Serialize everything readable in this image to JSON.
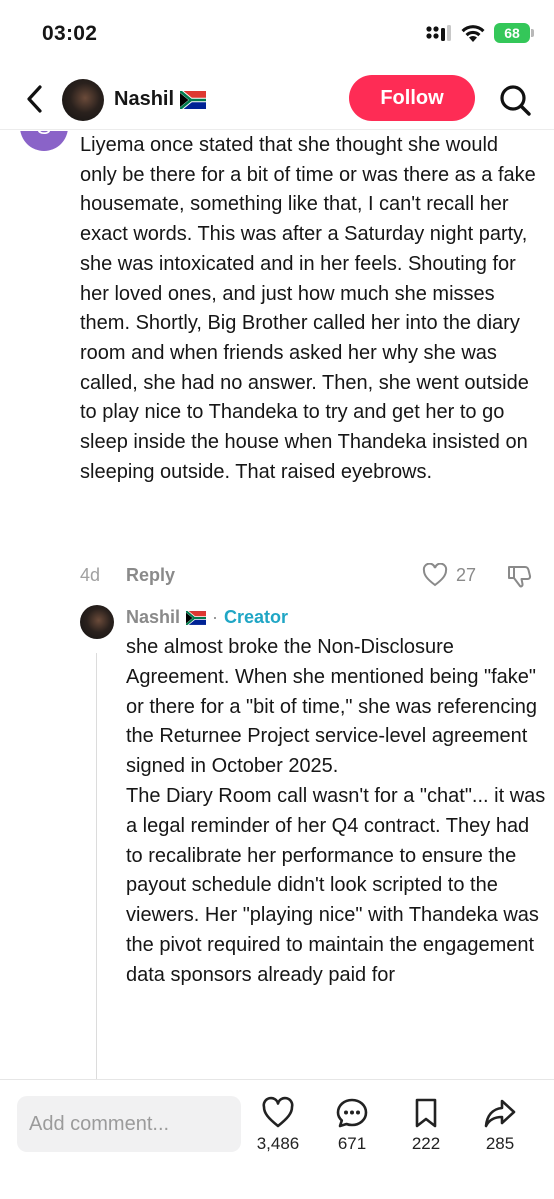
{
  "status_bar": {
    "time": "03:02",
    "battery": "68",
    "icons": [
      "signal-icon",
      "wifi-icon",
      "battery-icon"
    ]
  },
  "header": {
    "username": "Nashil",
    "flag": "south-africa-flag",
    "follow_label": "Follow",
    "icons": [
      "back-chevron-icon",
      "search-icon"
    ]
  },
  "comment": {
    "avatar_letter": "S",
    "text": "Liyema once stated that she thought she would only be there for a bit of time or was there as a fake housemate, something like that, I can't recall her exact words. This was after a Saturday night party, she was intoxicated and in her feels. Shouting for her loved ones, and just how much she misses them. Shortly, Big Brother called her into the diary room and when friends asked her why she was called, she had no answer. Then, she went outside to play nice to Thandeka to try and get her to go sleep inside the house when Thandeka insisted on sleeping outside. That raised eyebrows.",
    "date": "4d",
    "reply_label": "Reply",
    "likes": "27"
  },
  "reply": {
    "author": "Nashil",
    "separator": "·",
    "badge": "Creator",
    "text": "she almost broke the Non-Disclosure Agreement. When she mentioned being \"fake\" or there for a \"bit of time,\" she was referencing the Returnee Project service-level agreement signed in October 2025.\nThe Diary Room call wasn't for a \"chat\"... it was a legal reminder of her Q4 contract. They had to recalibrate her performance to ensure the payout schedule didn't look scripted to the viewers. Her \"playing nice\" with Thandeka was the pivot required to maintain the engagement data sponsors already paid for"
  },
  "bottom_bar": {
    "input_placeholder": "Add comment...",
    "likes": "3,486",
    "comments": "671",
    "saves": "222",
    "shares": "285"
  },
  "colors": {
    "follow": "#fe2c55",
    "creator": "#20a6c5",
    "avatar_s": "#8a63c8",
    "battery": "#34c759"
  }
}
